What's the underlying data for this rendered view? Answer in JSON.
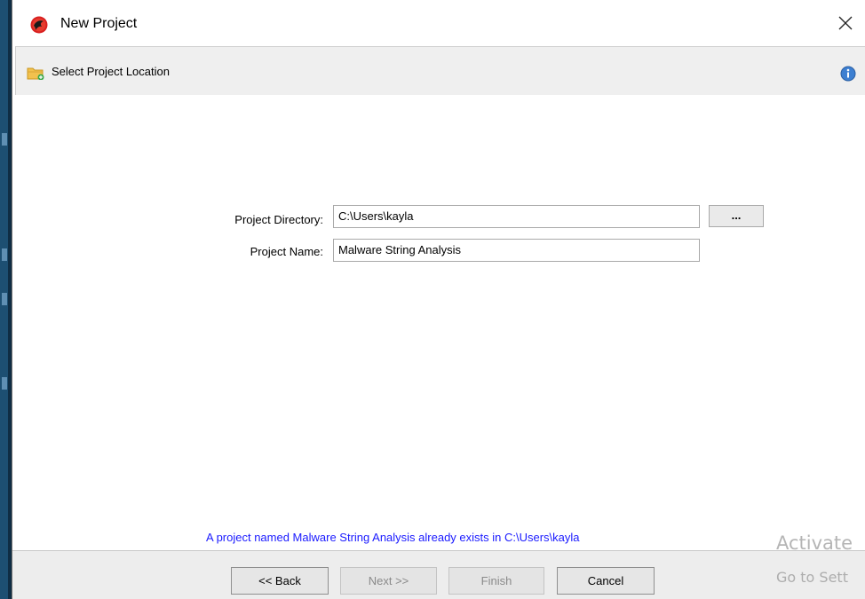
{
  "window": {
    "title": "New Project",
    "close_glyph": "✕"
  },
  "header": {
    "label": "Select Project Location",
    "icon": "folder-add-icon",
    "info_icon": "info-icon"
  },
  "form": {
    "directory_label": "Project Directory:",
    "directory_value": "C:\\Users\\kayla",
    "browse_label": "...",
    "name_label": "Project Name:",
    "name_value": "Malware String Analysis"
  },
  "status": {
    "message": "A project named Malware String Analysis already exists in C:\\Users\\kayla",
    "color": "#1a1aff"
  },
  "buttons": {
    "back": "<< Back",
    "next": "Next >>",
    "finish": "Finish",
    "cancel": "Cancel"
  },
  "watermark": {
    "line1": "Activate",
    "line2": "Go to Sett"
  }
}
